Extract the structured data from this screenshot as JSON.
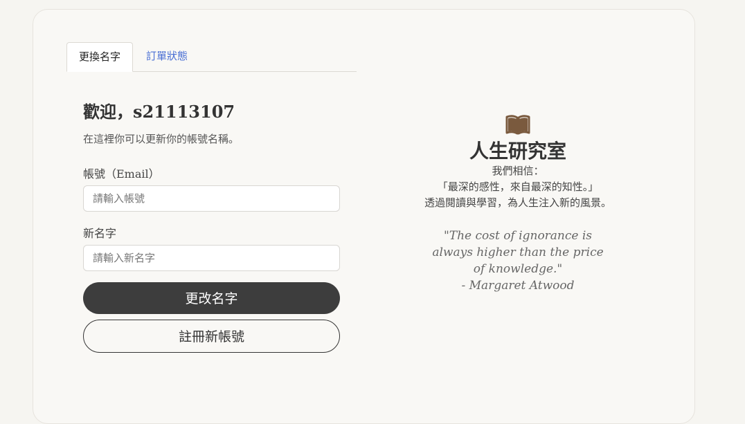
{
  "tabs": [
    {
      "label": "更換名字",
      "active": true
    },
    {
      "label": "訂單狀態",
      "active": false
    }
  ],
  "form": {
    "welcome": "歡迎，s21113107",
    "subtitle": "在這裡你可以更新你的帳號名稱。",
    "account_label": "帳號（Email）",
    "account_placeholder": "請輸入帳號",
    "name_label": "新名字",
    "name_placeholder": "請輸入新名字",
    "submit_label": "更改名字",
    "register_label": "註冊新帳號"
  },
  "brand": {
    "icon": "book-icon",
    "name": "人生研究室",
    "belief_lines": [
      "我們相信：",
      "「最深的感性，來自最深的知性。」",
      "透過閱讀與學習，為人生注入新的風景。"
    ],
    "quote": "\"The cost of ignorance is always higher than the price of knowledge.\"",
    "quote_author": "- Margaret Atwood"
  },
  "colors": {
    "background": "#f6f5f1",
    "card": "#f9f8f5",
    "primary_button": "#3d3d3d",
    "link": "#4a6fd4",
    "book_icon": "#7a5a3e"
  }
}
